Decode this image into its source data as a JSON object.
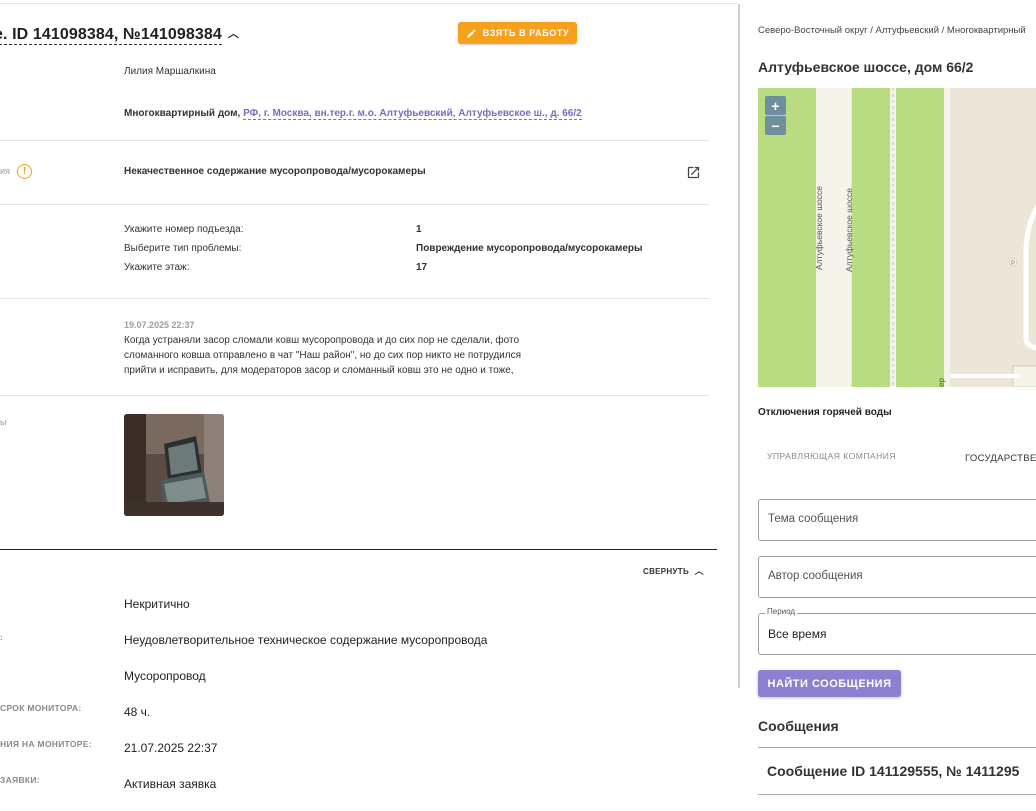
{
  "ticket": {
    "title": "e. ID 141098384, №141098384",
    "take_button": "ВЗЯТЬ В РАБОТУ",
    "author": "Лилия Маршалкина",
    "address_prefix": "Многоквартирный дом,",
    "address_link": "РФ, г. Москва, вн.тер.г. м.о. Алтуфьевский, Алтуфьевское ш., д. 66/2",
    "category_label_cut": "ия",
    "category": "Некачественное содержание мусоропровода/мусорокамеры",
    "details": [
      {
        "label": "Укажите номер подъезда:",
        "value": "1"
      },
      {
        "label": "Выберите тип проблемы:",
        "value": "Повреждение мусоропровода/мусорокамеры"
      },
      {
        "label": "Укажите этаж:",
        "value": "17"
      }
    ],
    "comment_date": "19.07.2025 22:37",
    "comment_text": "Когда устраняли засор сломали ковш мусоропровода и до сих пор не сделали, фото сломанного ковша отправлено в чат \"Наш район\", но до сих пор никто не потрудился прийти и исправить, для модераторов засор и сломанный ковш это не одно и тоже,",
    "photo_label_cut": "ы",
    "collapse_label": "СВЕРНУТЬ",
    "fields": [
      {
        "label": "",
        "value": "Некритично"
      },
      {
        "label": ":",
        "value": "Неудовлетворительное техническое содержание мусоропровода"
      },
      {
        "label": "",
        "value": "Мусоропровод"
      },
      {
        "label": "СРОК МОНИТОРА:",
        "value": "48 ч."
      },
      {
        "label": "НИЯ НА МОНИТОРЕ:",
        "value": "21.07.2025 22:37"
      },
      {
        "label": "ЗАЯВКИ:",
        "value": "Активная заявка"
      }
    ]
  },
  "side": {
    "breadcrumb": "Северо-Восточный округ / Алтуфьевский / Многоквартирный",
    "address_title": "Алтуфьевское шоссе, дом 66/2",
    "map": {
      "zoom_in": "+",
      "zoom_out": "−",
      "street1": "Алтуфьевское шоссе",
      "street2": "Алтуфьевское шоссе",
      "poi": "P",
      "partial_label": "ер"
    },
    "hot_water": "Отключения горячей воды",
    "tab_company": "УПРАВЛЯЮЩАЯ КОМПАНИЯ",
    "tab_state": "ГОСУДАРСТВЕ",
    "subject_placeholder": "Тема сообщения",
    "author_placeholder": "Автор сообщения",
    "period_label": "Период",
    "period_value": "Все время",
    "find_button": "НАЙТИ СООБЩЕНИЯ",
    "messages_heading": "Сообщения",
    "message_item": "Сообщение ID 141129555, № 1411295"
  },
  "colors": {
    "accent_orange": "#f5a11b",
    "accent_purple": "#8f7fd0",
    "link_purple": "#7a6cc0",
    "map_green": "#b9dc82"
  }
}
